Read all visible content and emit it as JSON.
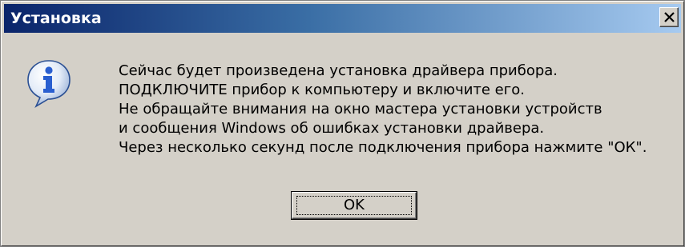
{
  "window": {
    "title": "Установка",
    "close_icon": "close-icon"
  },
  "dialog": {
    "icon": "info-icon",
    "message_lines": [
      "Сейчас будет произведена установка драйвера прибора.",
      "ПОДКЛЮЧИТЕ прибор к компьютеру и включите его.",
      "Не обращайте внимания на окно мастера установки устройств",
      "и сообщения Windows об ошибках установки драйвера.",
      "Через несколько секунд после подключения прибора нажмите \"ОК\"."
    ],
    "ok_label": "OK"
  },
  "colors": {
    "titlebar_start": "#0a246a",
    "titlebar_end": "#a6caf0",
    "dialog_bg": "#d4d0c8",
    "icon_blue": "#2a5fd0"
  }
}
